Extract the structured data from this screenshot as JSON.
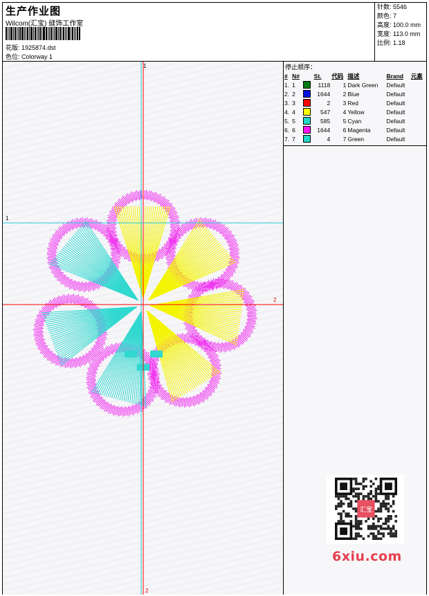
{
  "header": {
    "title": "生产作业图",
    "subtitle": "Wilcom(汇宝) 缝饰工作室",
    "design_label": "花版: 1925874.dst",
    "colorway_label": "色位: Colorway 1"
  },
  "stats": [
    {
      "label": "针数",
      "value": "5546"
    },
    {
      "label": "颜色",
      "value": "7"
    },
    {
      "label": "高度",
      "value": "100.0 mm"
    },
    {
      "label": "宽度",
      "value": "113.0 mm"
    },
    {
      "label": "比例",
      "value": "1.18"
    }
  ],
  "guides": {
    "v1_label": "1",
    "v2_label": "2",
    "h1_label": "1",
    "h2_label": "2"
  },
  "stop_panel": {
    "heading": "停止顺序：",
    "columns": [
      "#",
      "N#",
      "St.",
      "代码",
      "描述",
      "Brand",
      "元素"
    ],
    "rows": [
      {
        "idx": "1.",
        "n": "1",
        "color": "#007a12",
        "st": "1118",
        "code": "1",
        "desc": "Dark Green",
        "brand": "Default"
      },
      {
        "idx": "2.",
        "n": "2",
        "color": "#0010e0",
        "st": "1644",
        "code": "2",
        "desc": "Blue",
        "brand": "Default"
      },
      {
        "idx": "3.",
        "n": "3",
        "color": "#ff0000",
        "st": "2",
        "code": "3",
        "desc": "Red",
        "brand": "Default"
      },
      {
        "idx": "4.",
        "n": "4",
        "color": "#ffff00",
        "st": "547",
        "code": "4",
        "desc": "Yellow",
        "brand": "Default"
      },
      {
        "idx": "5.",
        "n": "5",
        "color": "#20d8c8",
        "st": "585",
        "code": "5",
        "desc": "Cyan",
        "brand": "Default"
      },
      {
        "idx": "6.",
        "n": "6",
        "color": "#ff10ff",
        "st": "1644",
        "code": "6",
        "desc": "Magenta",
        "brand": "Default"
      },
      {
        "idx": "7.",
        "n": "7",
        "color": "#20d8c8",
        "st": "4",
        "code": "7",
        "desc": "Green",
        "brand": "Default"
      }
    ]
  },
  "watermark": {
    "site": "6xiu.com",
    "stamp_text": "汇宝"
  },
  "colors": {
    "magenta": "#ee22ee",
    "yellow": "#f4f400",
    "cyan": "#30d8d0",
    "guide_cyan": "#22c8d8",
    "guide_red": "#ff0000"
  }
}
